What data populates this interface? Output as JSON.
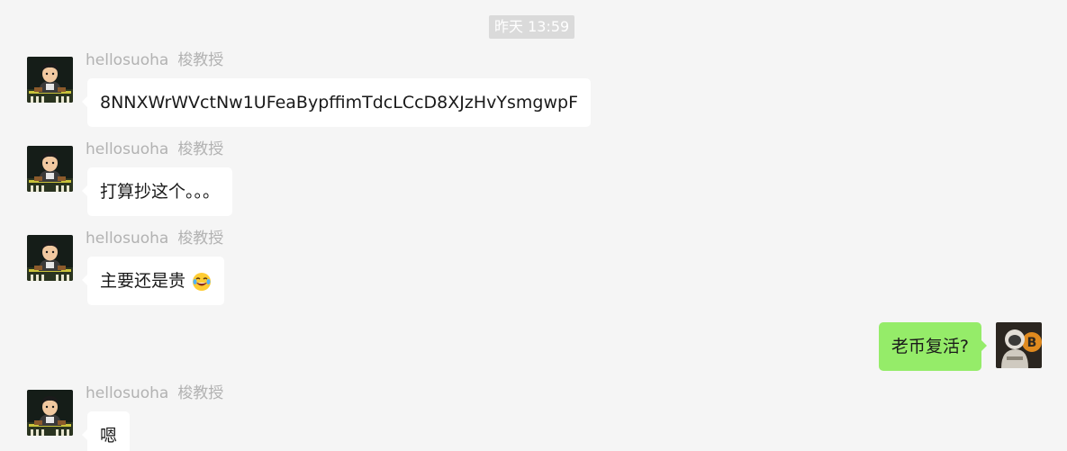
{
  "chat": {
    "timestamp": "昨天 13:59",
    "messages": [
      {
        "sender_name": "hellosuoha",
        "sender_group_name": "梭教授",
        "text": "8NNXWrWVctNw1UFeaBypffimTdcLCcD8XJzHvYsmgwpF",
        "avatar_icon": "cartoon-man-desk-avatar"
      },
      {
        "sender_name": "hellosuoha",
        "sender_group_name": "梭教授",
        "text": "打算抄这个。。。",
        "avatar_icon": "cartoon-man-desk-avatar"
      },
      {
        "sender_name": "hellosuoha",
        "sender_group_name": "梭教授",
        "text": "主要还是贵",
        "emoji": "tears-of-joy-emoji",
        "avatar_icon": "cartoon-man-desk-avatar"
      },
      {
        "self": true,
        "text": "老币复活?",
        "avatar_icon": "astronaut-bitcoin-avatar"
      },
      {
        "sender_name": "hellosuoha",
        "sender_group_name": "梭教授",
        "text": "嗯",
        "avatar_icon": "cartoon-man-desk-avatar"
      }
    ]
  },
  "colors": {
    "background": "#f5f5f5",
    "incoming_bubble": "#ffffff",
    "outgoing_bubble": "#95ec69",
    "sender_text": "#b2b2b2",
    "timestamp_bg": "#dadada"
  }
}
